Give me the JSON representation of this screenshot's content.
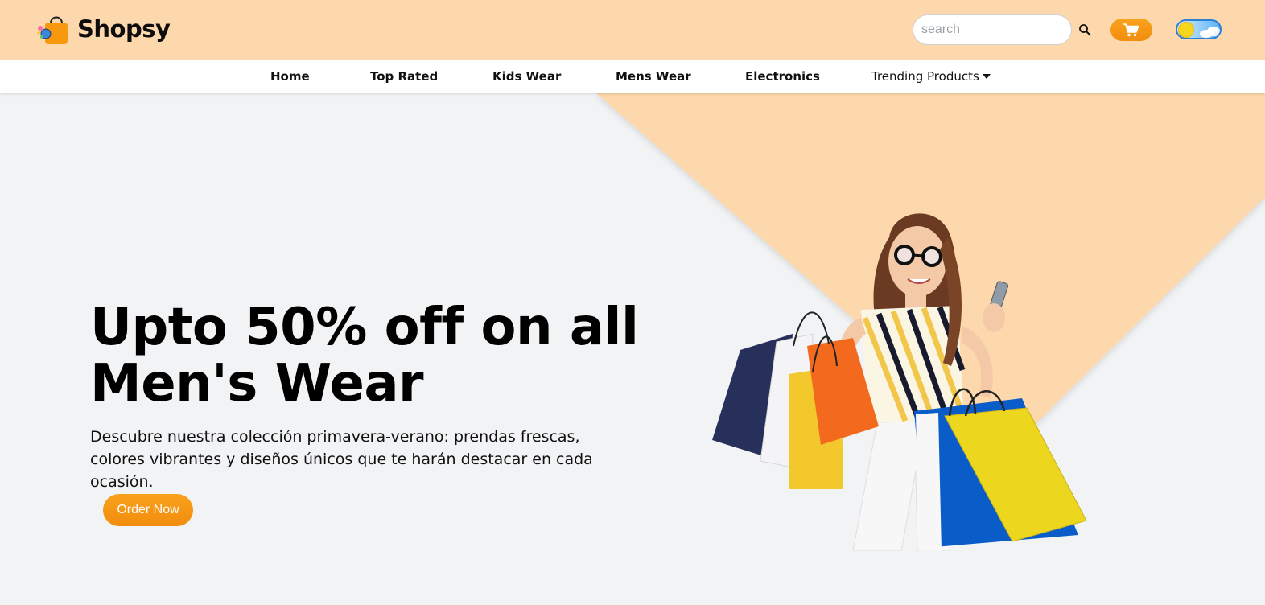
{
  "header": {
    "brand": "Shopsy",
    "search": {
      "placeholder": "search",
      "value": ""
    },
    "icons": {
      "search": "search-icon",
      "cart": "cart-icon",
      "theme": "theme-toggle-icon"
    },
    "colors": {
      "header_bg": "#fdd8ac",
      "accent": "#f8980f"
    }
  },
  "nav": {
    "items": [
      {
        "label": "Home"
      },
      {
        "label": "Top Rated"
      },
      {
        "label": "Kids Wear"
      },
      {
        "label": "Mens Wear"
      },
      {
        "label": "Electronics"
      },
      {
        "label": "Trending Products"
      }
    ]
  },
  "hero": {
    "title": "Upto 50% off on all Men's Wear",
    "description": "Descubre nuestra colección primavera-verano: prendas frescas, colores vibrantes y diseños únicos que te harán destacar en cada ocasión.",
    "button_label": "Order Now",
    "colors": {
      "background": "#f2f3f5",
      "triangle": "#fdd8ac"
    }
  }
}
